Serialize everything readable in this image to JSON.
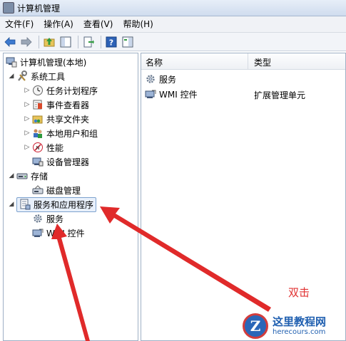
{
  "window": {
    "title": "计算机管理"
  },
  "menu": [
    {
      "label": "文件(F)"
    },
    {
      "label": "操作(A)"
    },
    {
      "label": "查看(V)"
    },
    {
      "label": "帮助(H)"
    }
  ],
  "toolbar": {
    "buttons": [
      "back-arrow-icon",
      "forward-arrow-icon",
      "up-folder-icon",
      "show-hide-tree-icon",
      "export-list-icon",
      "help-icon",
      "properties-panel-icon"
    ]
  },
  "tree": {
    "root": "计算机管理(本地)",
    "system_tools": "系统工具",
    "task_scheduler": "任务计划程序",
    "event_viewer": "事件查看器",
    "shared_folders": "共享文件夹",
    "local_users": "本地用户和组",
    "performance": "性能",
    "device_manager": "设备管理器",
    "storage": "存储",
    "disk_management": "磁盘管理",
    "services_apps": "服务和应用程序",
    "services": "服务",
    "wmi": "WMI 控件"
  },
  "list": {
    "columns": {
      "name": "名称",
      "type": "类型"
    },
    "rows": [
      {
        "name": "服务",
        "type": ""
      },
      {
        "name": "WMI 控件",
        "type": "扩展管理单元"
      }
    ]
  },
  "annotation": {
    "text": "双击",
    "color": "#e03030"
  },
  "watermark": {
    "logo_letter": "Z",
    "site_name": "这里教程网",
    "url": "herecours.com"
  }
}
